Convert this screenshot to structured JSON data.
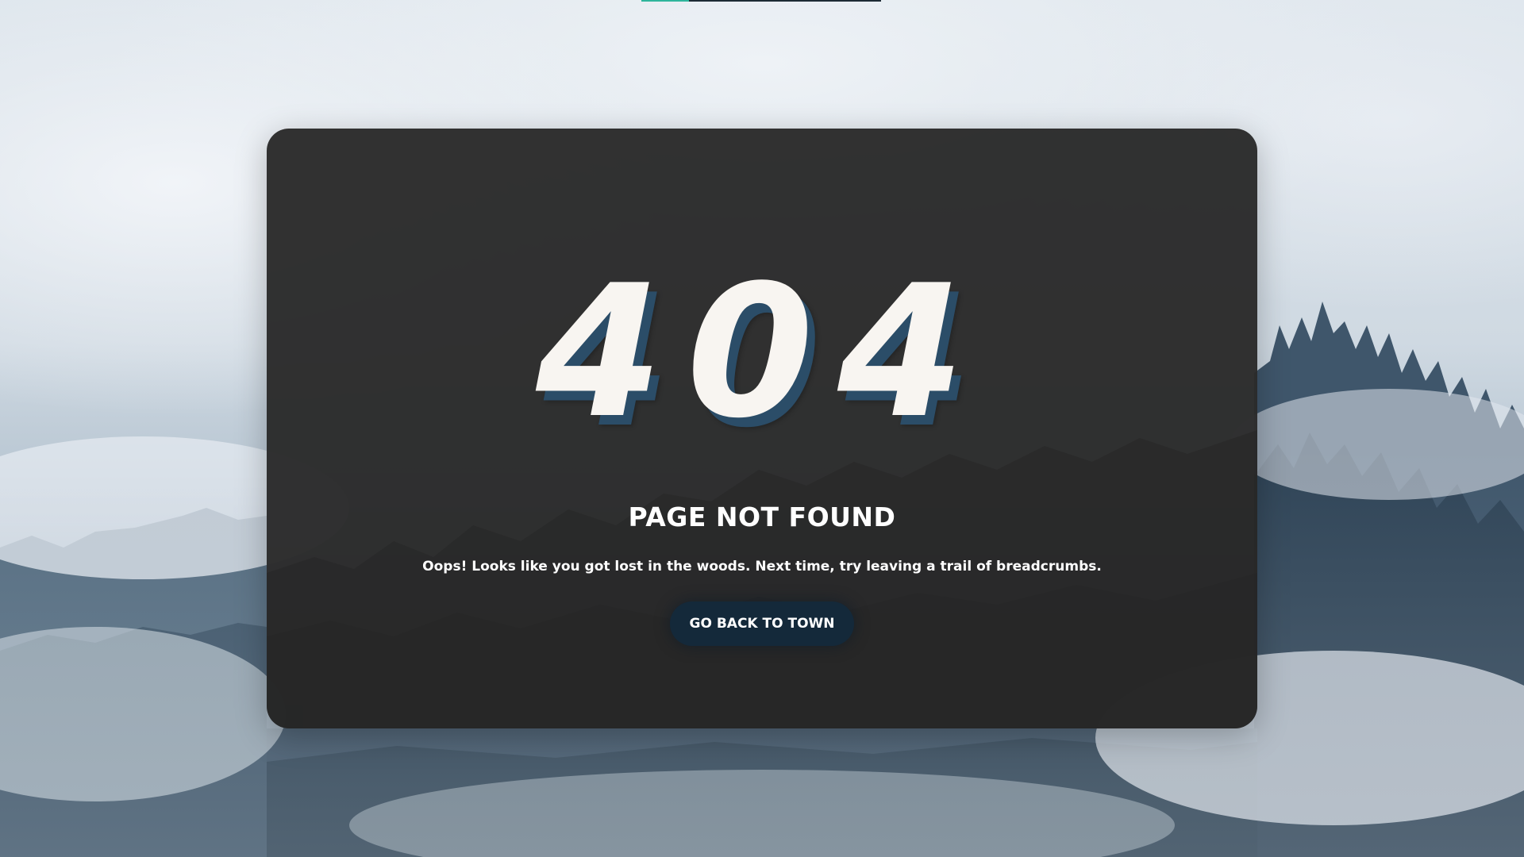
{
  "loader": {
    "progress": 0.2,
    "track_color": "#1d2a34",
    "fill_color": "#2fb59c"
  },
  "error": {
    "code": "404",
    "title": "PAGE NOT FOUND",
    "message": "Oops! Looks like you got lost in the woods. Next time, try leaving a trail of breadcrumbs.",
    "button_label": "GO BACK TO TOWN"
  },
  "colors": {
    "card_background": "#2a2a2a",
    "code_text": "#f8f5f1",
    "code_shadow": "#2b4d68",
    "button_background": "#14293a",
    "text": "#ffffff"
  },
  "background": {
    "scene": "misty-forest-image"
  }
}
